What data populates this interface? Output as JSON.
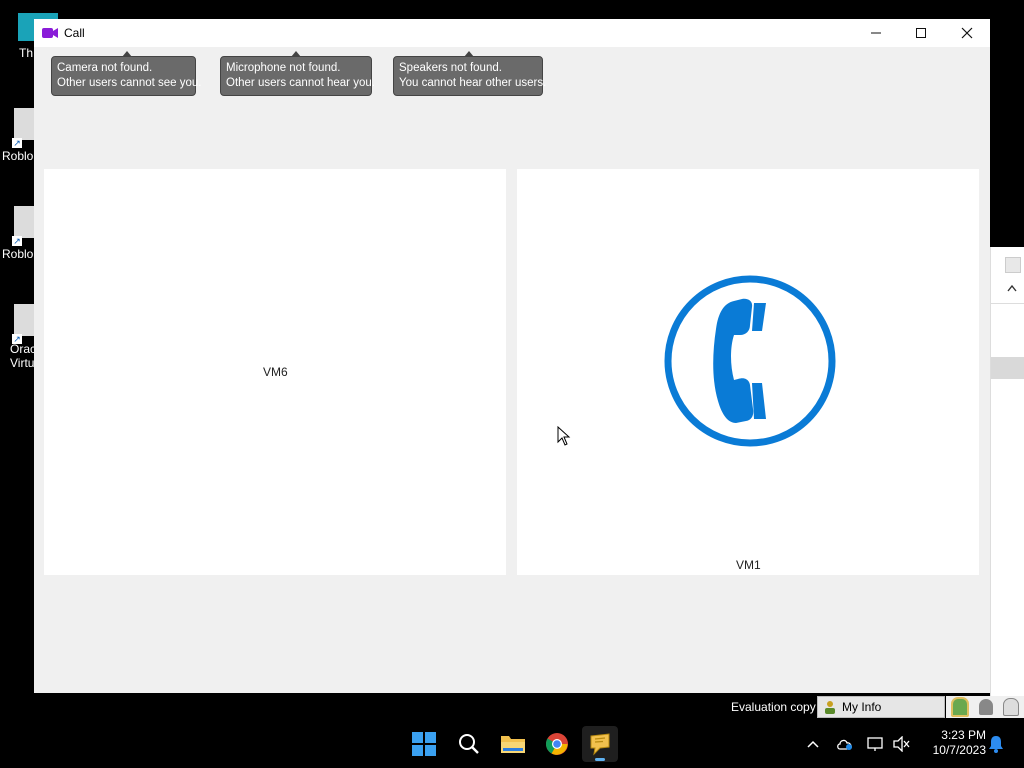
{
  "desktop": {
    "icons": [
      {
        "label": "Th"
      },
      {
        "label": "Roblo"
      },
      {
        "label": "Roblo"
      },
      {
        "label": "Orac",
        "label2": "Virtu"
      }
    ]
  },
  "call_window": {
    "title": "Call",
    "controls": {
      "minimize": "minimize",
      "maximize": "maximize",
      "close": "close"
    },
    "notices": {
      "camera": {
        "line1": "Camera not found.",
        "line2": "Other users cannot see you."
      },
      "microphone": {
        "line1": "Microphone not found.",
        "line2": "Other users cannot hear you."
      },
      "speakers": {
        "line1": "Speakers not found.",
        "line2": "You cannot hear other users."
      }
    },
    "participants": [
      {
        "name": "VM6"
      },
      {
        "name": "VM1"
      }
    ],
    "accent_color": "#0a7bd6"
  },
  "status_strip": {
    "evaluation_text": "Evaluation copy",
    "my_info_label": "My Info"
  },
  "taskbar": {
    "apps": [
      "windows-start",
      "search",
      "file-explorer",
      "chrome",
      "messenger"
    ],
    "clock": {
      "time": "3:23 PM",
      "date": "10/7/2023"
    }
  }
}
